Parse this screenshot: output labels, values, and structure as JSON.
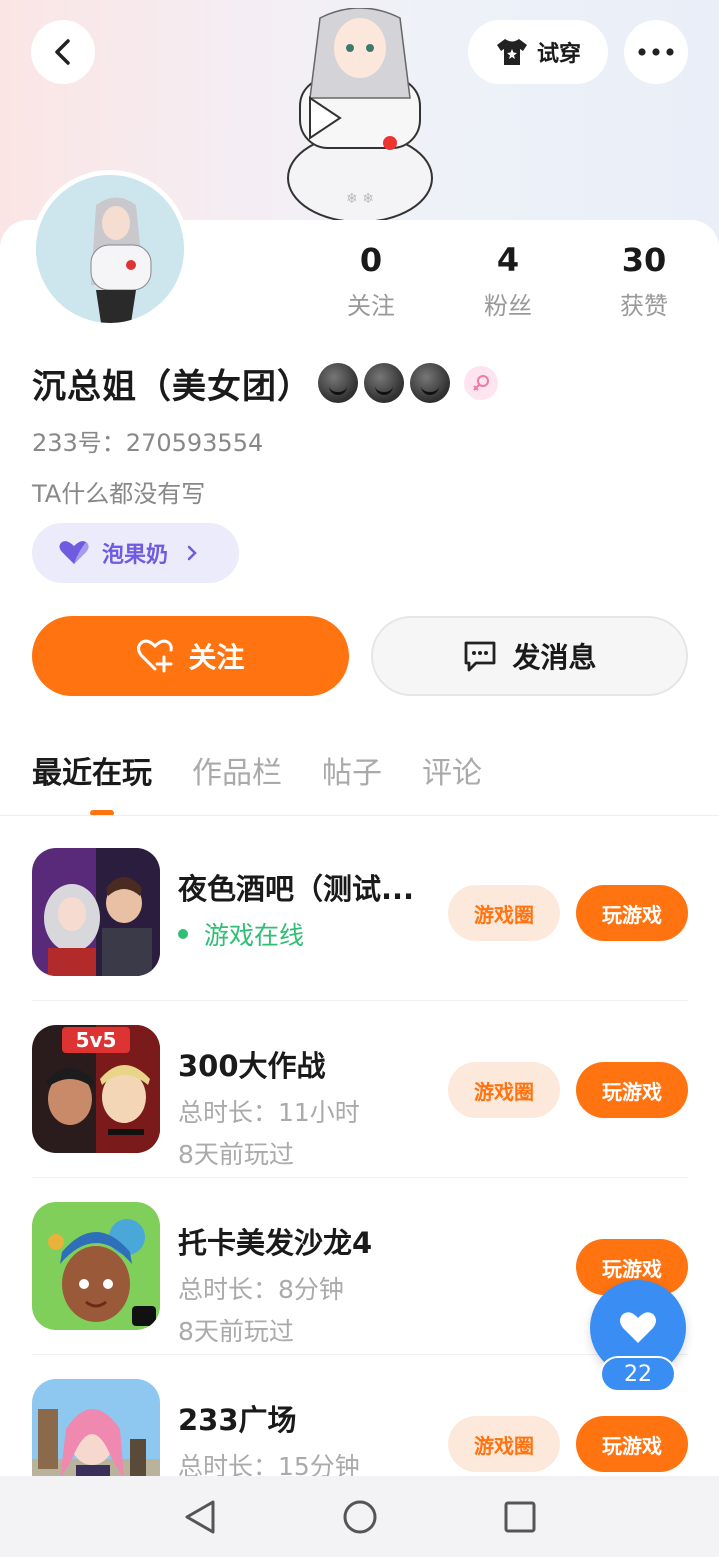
{
  "header": {
    "tryon_label": "试穿"
  },
  "profile": {
    "stats": [
      {
        "value": "0",
        "label": "关注"
      },
      {
        "value": "4",
        "label": "粉丝"
      },
      {
        "value": "30",
        "label": "获赞"
      }
    ],
    "name": "沉总姐（美女团）",
    "uid": "233号：270593554",
    "bio": "TA什么都没有写",
    "badge": "泡果奶"
  },
  "actions": {
    "follow": "关注",
    "message": "发消息"
  },
  "tabs": [
    "最近在玩",
    "作品栏",
    "帖子",
    "评论"
  ],
  "games": [
    {
      "title": "夜色酒吧（测试...",
      "status": "游戏在线",
      "circle": "游戏圈",
      "play": "玩游戏"
    },
    {
      "title": "300大作战",
      "duration": "总时长：11小时",
      "last": "8天前玩过",
      "circle": "游戏圈",
      "play": "玩游戏"
    },
    {
      "title": "托卡美发沙龙4",
      "duration": "总时长：8分钟",
      "last": "8天前玩过",
      "play": "玩游戏"
    },
    {
      "title": "233广场",
      "duration": "总时长：15分钟",
      "circle": "游戏圈",
      "play": "玩游戏"
    }
  ],
  "fab": {
    "count": "22"
  },
  "colors": {
    "accent": "#ff7310",
    "online": "#2fbf74",
    "fab": "#3a8df2",
    "badge": "#6e5be0"
  }
}
